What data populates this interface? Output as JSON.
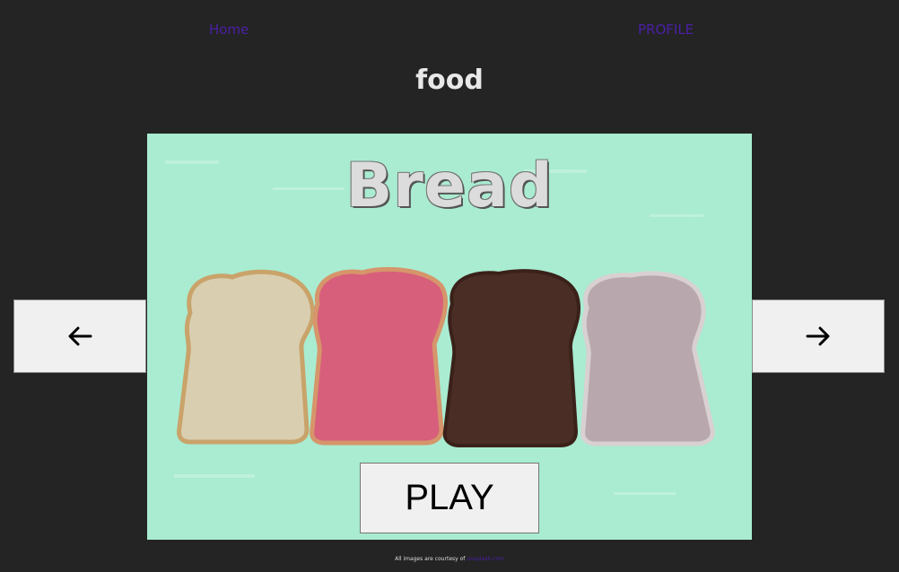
{
  "nav": {
    "home_label": "Home",
    "profile_label": "PROFILE"
  },
  "category": {
    "title": "food"
  },
  "card": {
    "food_name": "Bread",
    "image_icon": "bread-slices-photo",
    "background_color": "#a9ecd1"
  },
  "controls": {
    "prev_icon": "arrow-left-icon",
    "next_icon": "arrow-right-icon",
    "play_label": "PLAY"
  },
  "footer": {
    "credit_text": "All images are courtesy of",
    "credit_link": "unsplash.com"
  },
  "colors": {
    "background": "#242424",
    "link": "#4b1fa6",
    "title": "#e8e8e8",
    "button": "#f0f0f0"
  }
}
